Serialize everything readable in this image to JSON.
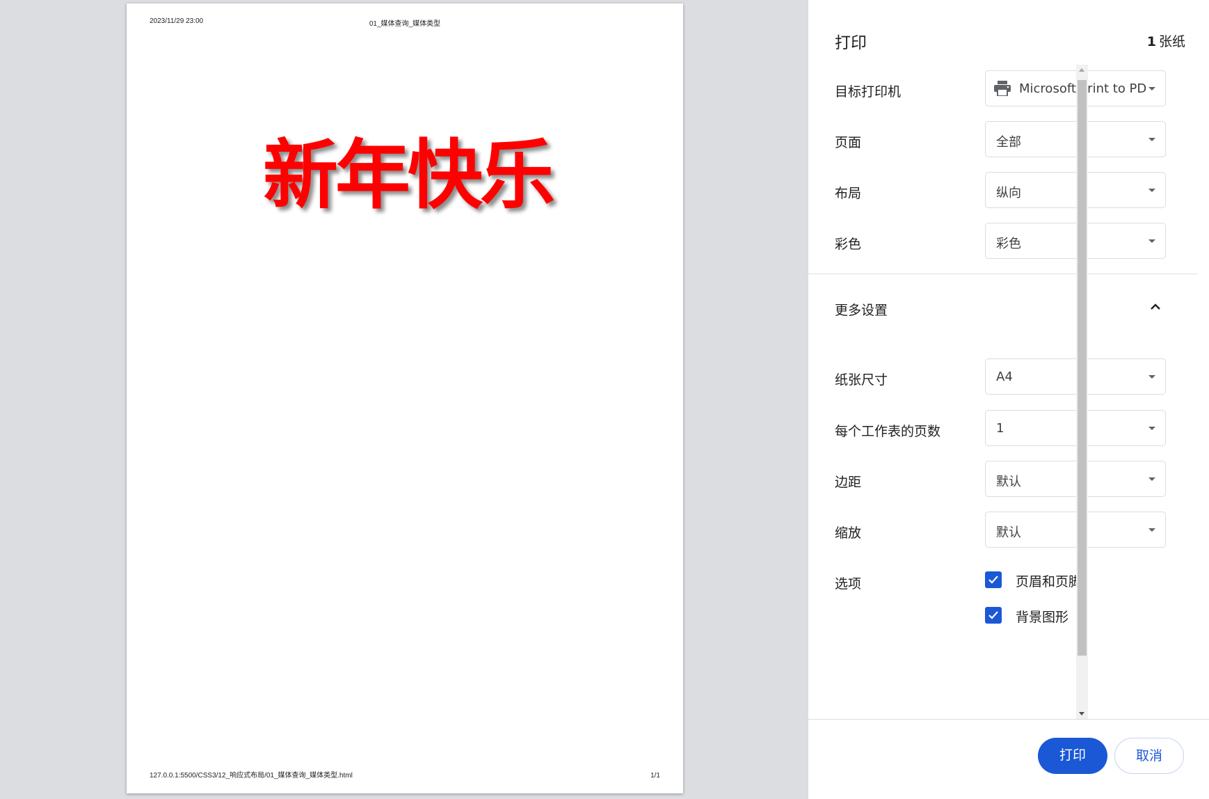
{
  "preview": {
    "header_date": "2023/11/29 23:00",
    "header_title": "01_媒体查询_媒体类型",
    "headline": "新年快乐",
    "footer_url": "127.0.0.1:5500/CSS3/12_响应式布局/01_媒体查询_媒体类型.html",
    "footer_page": "1/1"
  },
  "panel": {
    "title": "打印",
    "sheet_count_num": "1",
    "sheet_count_unit": "张纸",
    "settings": {
      "destination": {
        "label": "目标打印机",
        "value": "Microsoft Print to PD"
      },
      "pages": {
        "label": "页面",
        "value": "全部"
      },
      "layout": {
        "label": "布局",
        "value": "纵向"
      },
      "color": {
        "label": "彩色",
        "value": "彩色"
      }
    },
    "more_settings": "更多设置",
    "advanced": {
      "paper_size": {
        "label": "纸张尺寸",
        "value": "A4"
      },
      "pages_per_sheet": {
        "label": "每个工作表的页数",
        "value": "1"
      },
      "margins": {
        "label": "边距",
        "value": "默认"
      },
      "scale": {
        "label": "缩放",
        "value": "默认"
      }
    },
    "options": {
      "label": "选项",
      "headers_footers": "页眉和页脚",
      "background_graphics": "背景图形"
    },
    "buttons": {
      "print": "打印",
      "cancel": "取消"
    }
  },
  "colors": {
    "accent": "#1a58d6",
    "headline": "#ff0000"
  }
}
